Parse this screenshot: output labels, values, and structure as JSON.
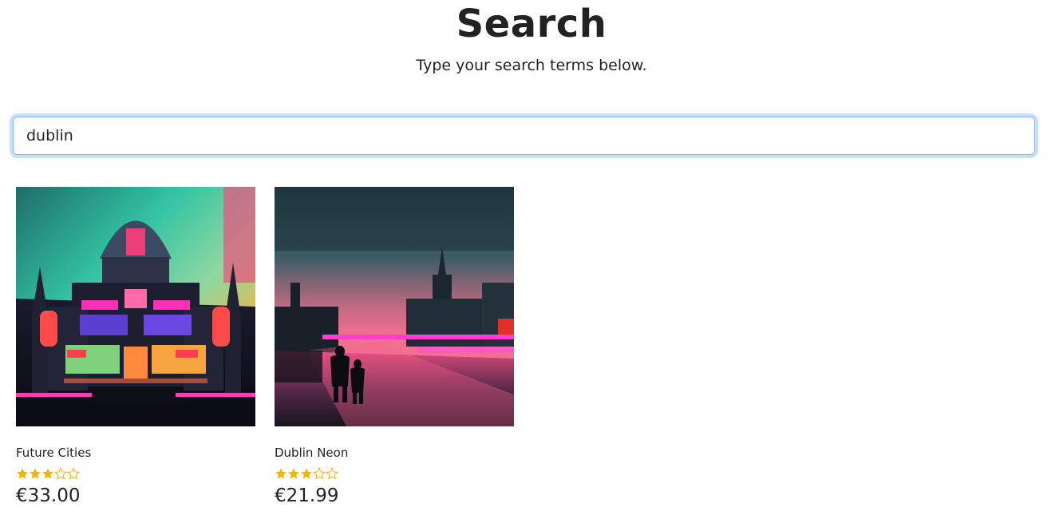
{
  "header": {
    "title": "Search",
    "subtitle": "Type your search terms below."
  },
  "search": {
    "value": "dublin",
    "placeholder": ""
  },
  "colors": {
    "star_fill": "#f4b400",
    "focus_border": "#86b7fe"
  },
  "results": [
    {
      "image": "neon-cyberpunk-dome-building-image",
      "title": "Future Cities",
      "rating": 3,
      "rating_max": 5,
      "price": "€33.00"
    },
    {
      "image": "neon-dublin-river-night-image",
      "title": "Dublin Neon",
      "rating": 3,
      "rating_max": 5,
      "price": "€21.99"
    }
  ]
}
